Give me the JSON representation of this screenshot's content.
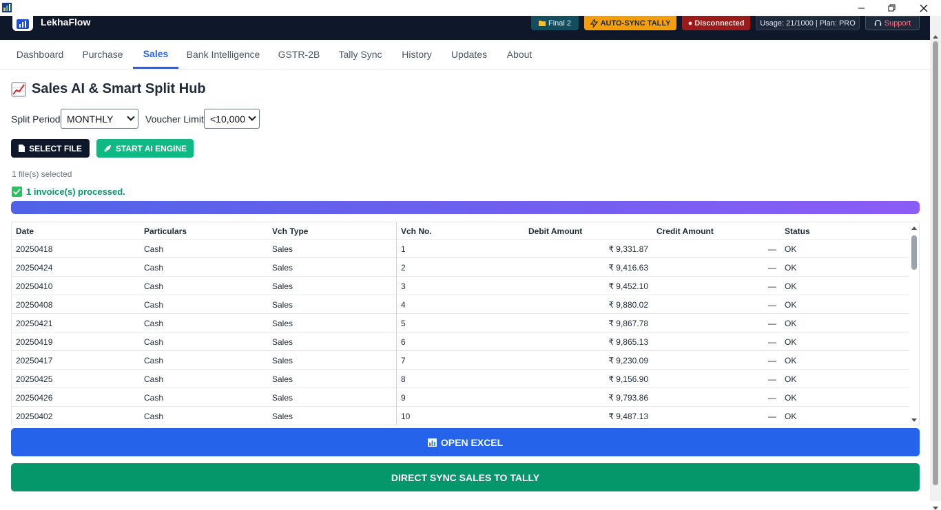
{
  "window": {
    "minimize": "─",
    "maximize": "❐",
    "close": "✕"
  },
  "header": {
    "brand": "LekhaFlow",
    "badges": {
      "final": "Final 2",
      "auto_sync": "AUTO-SYNC TALLY",
      "status": "● Disconnected",
      "usage": "Usage: 21/1000 | Plan: PRO",
      "support": "Support"
    }
  },
  "tabs": [
    "Dashboard",
    "Purchase",
    "Sales",
    "Bank Intelligence",
    "GSTR-2B",
    "Tally Sync",
    "History",
    "Updates",
    "About"
  ],
  "active_tab": "Sales",
  "page": {
    "title": "Sales AI & Smart Split Hub",
    "split_period_label": "Split Period:",
    "split_period_value": "MONTHLY",
    "voucher_limit_label": "Voucher Limit:",
    "voucher_limit_value": "<10,000",
    "select_file": "SELECT FILE",
    "start_engine": "START AI ENGINE",
    "files_selected": "1 file(s) selected",
    "processed": "1 invoice(s) processed.",
    "progress": 1.0
  },
  "table": {
    "columns": [
      "Date",
      "Particulars",
      "Vch Type",
      "Vch No.",
      "Debit Amount",
      "Credit Amount",
      "Status"
    ],
    "rows": [
      [
        "20250418",
        "Cash",
        "Sales",
        "1",
        "₹ 9,331.87",
        "—",
        "OK"
      ],
      [
        "20250424",
        "Cash",
        "Sales",
        "2",
        "₹ 9,416.63",
        "—",
        "OK"
      ],
      [
        "20250410",
        "Cash",
        "Sales",
        "3",
        "₹ 9,452.10",
        "—",
        "OK"
      ],
      [
        "20250408",
        "Cash",
        "Sales",
        "4",
        "₹ 9,880.02",
        "—",
        "OK"
      ],
      [
        "20250421",
        "Cash",
        "Sales",
        "5",
        "₹ 9,867.78",
        "—",
        "OK"
      ],
      [
        "20250419",
        "Cash",
        "Sales",
        "6",
        "₹ 9,865.13",
        "—",
        "OK"
      ],
      [
        "20250417",
        "Cash",
        "Sales",
        "7",
        "₹ 9,230.09",
        "—",
        "OK"
      ],
      [
        "20250425",
        "Cash",
        "Sales",
        "8",
        "₹ 9,156.90",
        "—",
        "OK"
      ],
      [
        "20250426",
        "Cash",
        "Sales",
        "9",
        "₹ 9,793.86",
        "—",
        "OK"
      ],
      [
        "20250402",
        "Cash",
        "Sales",
        "10",
        "₹ 9,487.13",
        "—",
        "OK"
      ]
    ]
  },
  "actions": {
    "open_excel": "OPEN EXCEL",
    "direct_sync": "DIRECT SYNC SALES TO TALLY"
  },
  "colors": {
    "accent": "#2563eb",
    "success": "#059669",
    "header_bg": "#0f172a"
  }
}
